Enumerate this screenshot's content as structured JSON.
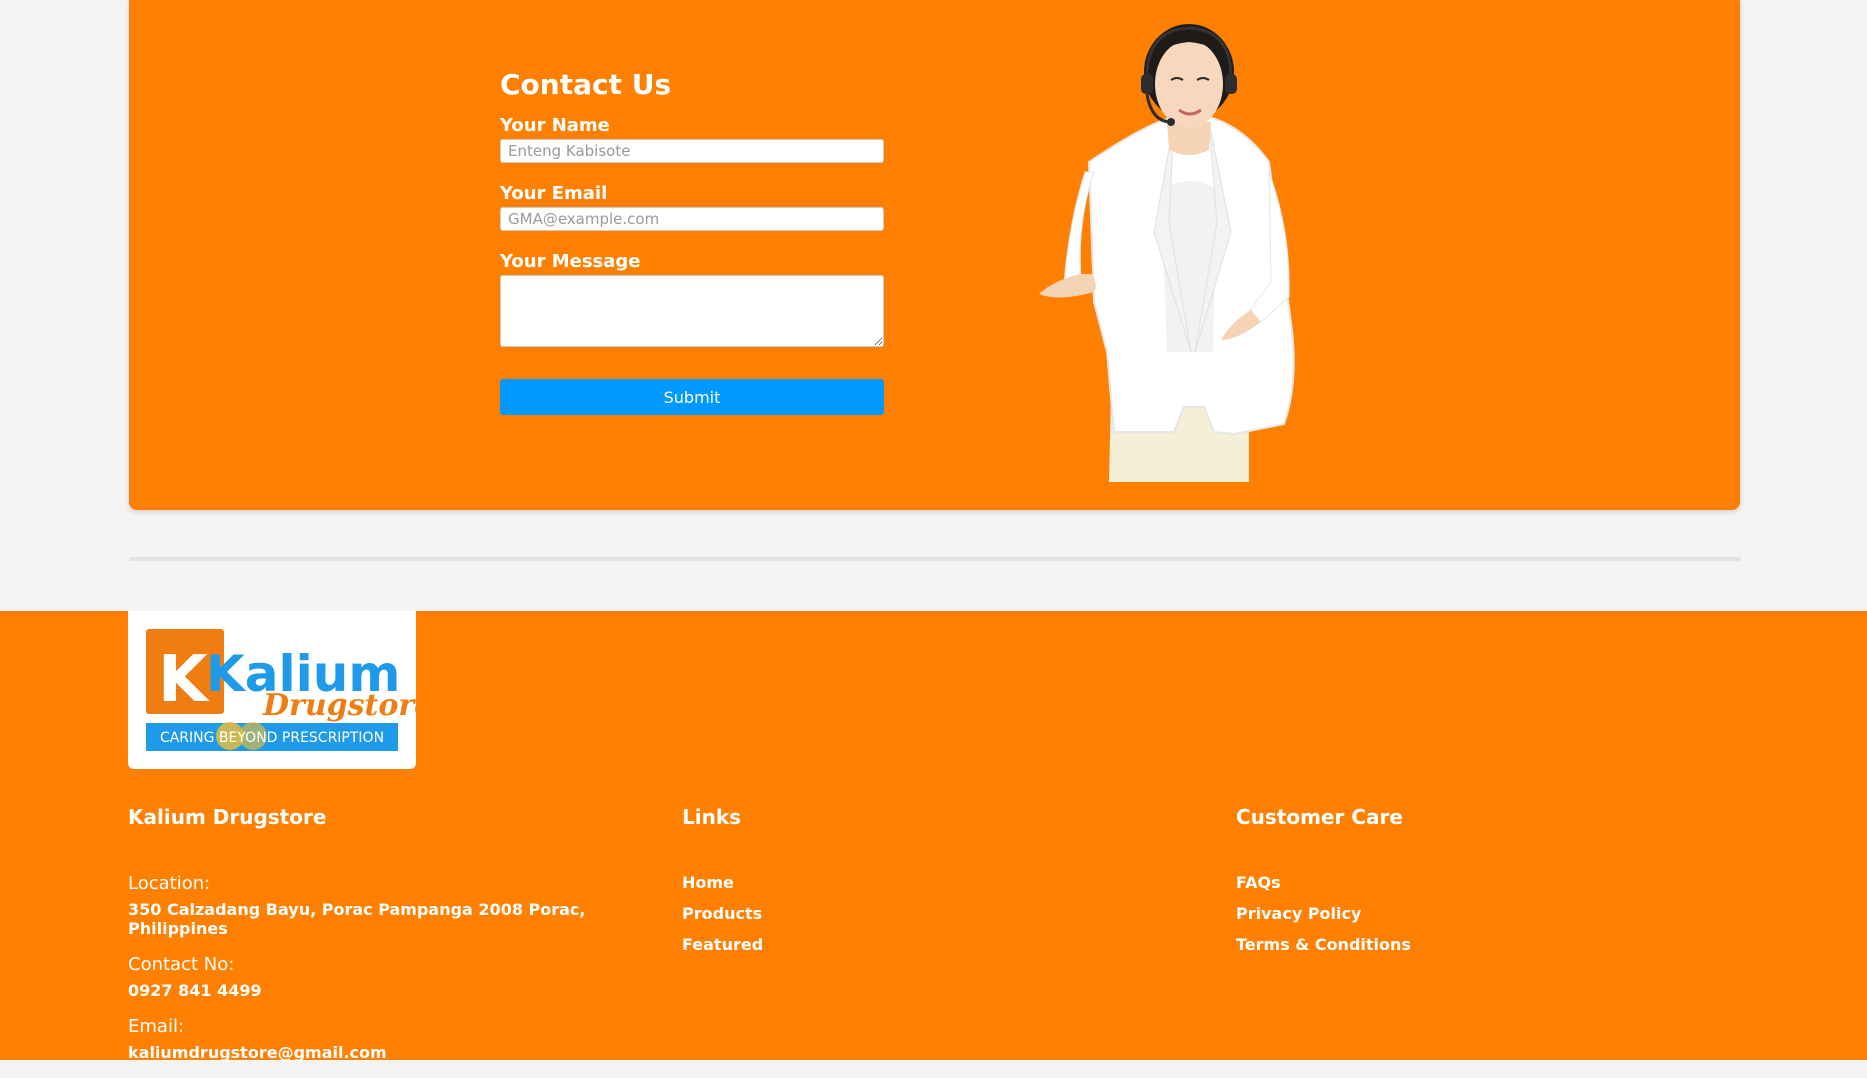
{
  "contact": {
    "title": "Contact Us",
    "name_label": "Your Name",
    "name_placeholder": "Enteng Kabisote",
    "email_label": "Your Email",
    "email_placeholder": "GMA@example.com",
    "message_label": "Your Message",
    "submit_label": "Submit"
  },
  "footer": {
    "logo": {
      "brand": "Kalium",
      "sub": "Drugstore",
      "tagline": "CARING BEYOND PRESCRIPTION"
    },
    "company": {
      "title": "Kalium Drugstore",
      "location_label": "Location:",
      "location_value": "350 Calzadang Bayu, Porac Pampanga 2008 Porac, Philippines",
      "contact_label": "Contact No:",
      "contact_value": "0927 841 4499",
      "email_label": "Email:",
      "email_value": "kaliumdrugstore@gmail.com"
    },
    "links": {
      "title": "Links",
      "items": [
        "Home",
        "Products",
        "Featured"
      ]
    },
    "care": {
      "title": "Customer Care",
      "items": [
        "FAQs",
        "Privacy Policy",
        "Terms & Conditions"
      ]
    }
  },
  "colors": {
    "brand_orange": "#ff8000",
    "submit_blue": "#0099ff",
    "logo_blue": "#1f9ae8",
    "page_bg": "#f4f4f4"
  }
}
